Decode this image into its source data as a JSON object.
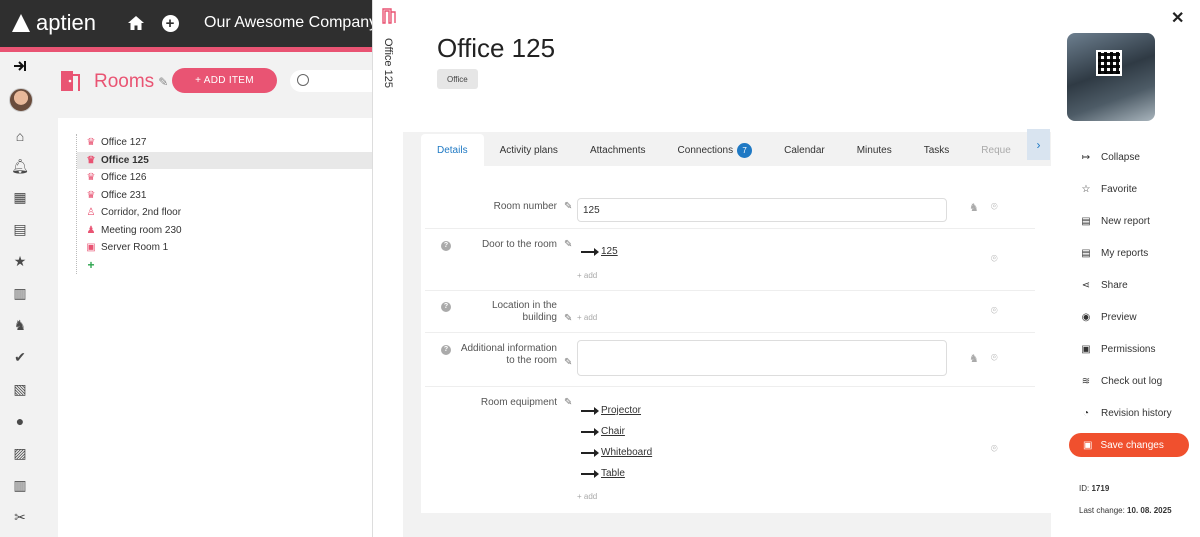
{
  "app": {
    "logo_text": "aptien",
    "company": "Our Awesome Company"
  },
  "rooms": {
    "title": "Rooms",
    "add_label": "+ ADD ITEM"
  },
  "tree": [
    {
      "label": "Office 127",
      "icon": "chair-icon",
      "selected": false
    },
    {
      "label": "Office 125",
      "icon": "chair-icon",
      "selected": true
    },
    {
      "label": "Office 126",
      "icon": "chair-icon",
      "selected": false
    },
    {
      "label": "Office 231",
      "icon": "chair-icon",
      "selected": false
    },
    {
      "label": "Corridor, 2nd floor",
      "icon": "walking-icon",
      "selected": false
    },
    {
      "label": "Meeting room 230",
      "icon": "people-icon",
      "selected": false
    },
    {
      "label": "Server Room 1",
      "icon": "server-icon",
      "selected": false
    }
  ],
  "vertical_title": "Office 125",
  "detail": {
    "title": "Office 125",
    "type_badge": "Office",
    "tabs": [
      {
        "label": "Details",
        "active": true
      },
      {
        "label": "Activity plans"
      },
      {
        "label": "Attachments"
      },
      {
        "label": "Connections",
        "badge": "7"
      },
      {
        "label": "Calendar"
      },
      {
        "label": "Minutes"
      },
      {
        "label": "Tasks"
      },
      {
        "label": "Reque"
      }
    ],
    "fields": {
      "room_number": {
        "label": "Room number",
        "value": "125"
      },
      "door": {
        "label": "Door to the room",
        "links": [
          "125"
        ],
        "add": "+ add"
      },
      "location": {
        "label_1": "Location in the",
        "label_2": "building",
        "add": "+ add"
      },
      "additional": {
        "label_1": "Additional information",
        "label_2": "to the room",
        "value": ""
      },
      "equipment": {
        "label": "Room equipment",
        "links": [
          "Projector",
          "Chair",
          "Whiteboard",
          "Table"
        ],
        "add": "+ add"
      }
    }
  },
  "actions": [
    {
      "label": "Collapse",
      "icon": "collapse-icon"
    },
    {
      "label": "Favorite",
      "icon": "star-icon"
    },
    {
      "label": "New report",
      "icon": "report-icon"
    },
    {
      "label": "My reports",
      "icon": "reports-icon"
    },
    {
      "label": "Share",
      "icon": "share-icon"
    },
    {
      "label": "Preview",
      "icon": "eye-icon"
    },
    {
      "label": "Permissions",
      "icon": "permissions-icon"
    },
    {
      "label": "Check out log",
      "icon": "log-icon"
    },
    {
      "label": "Revision history",
      "icon": "history-icon"
    }
  ],
  "save_label": "Save changes",
  "meta": {
    "id_label": "ID:",
    "id_value": "1719",
    "last_change_label": "Last change:",
    "last_change_value": "10. 08. 2025"
  },
  "colors": {
    "brand": "#e95473",
    "accent": "#1f79c4",
    "save": "#f0502e"
  }
}
